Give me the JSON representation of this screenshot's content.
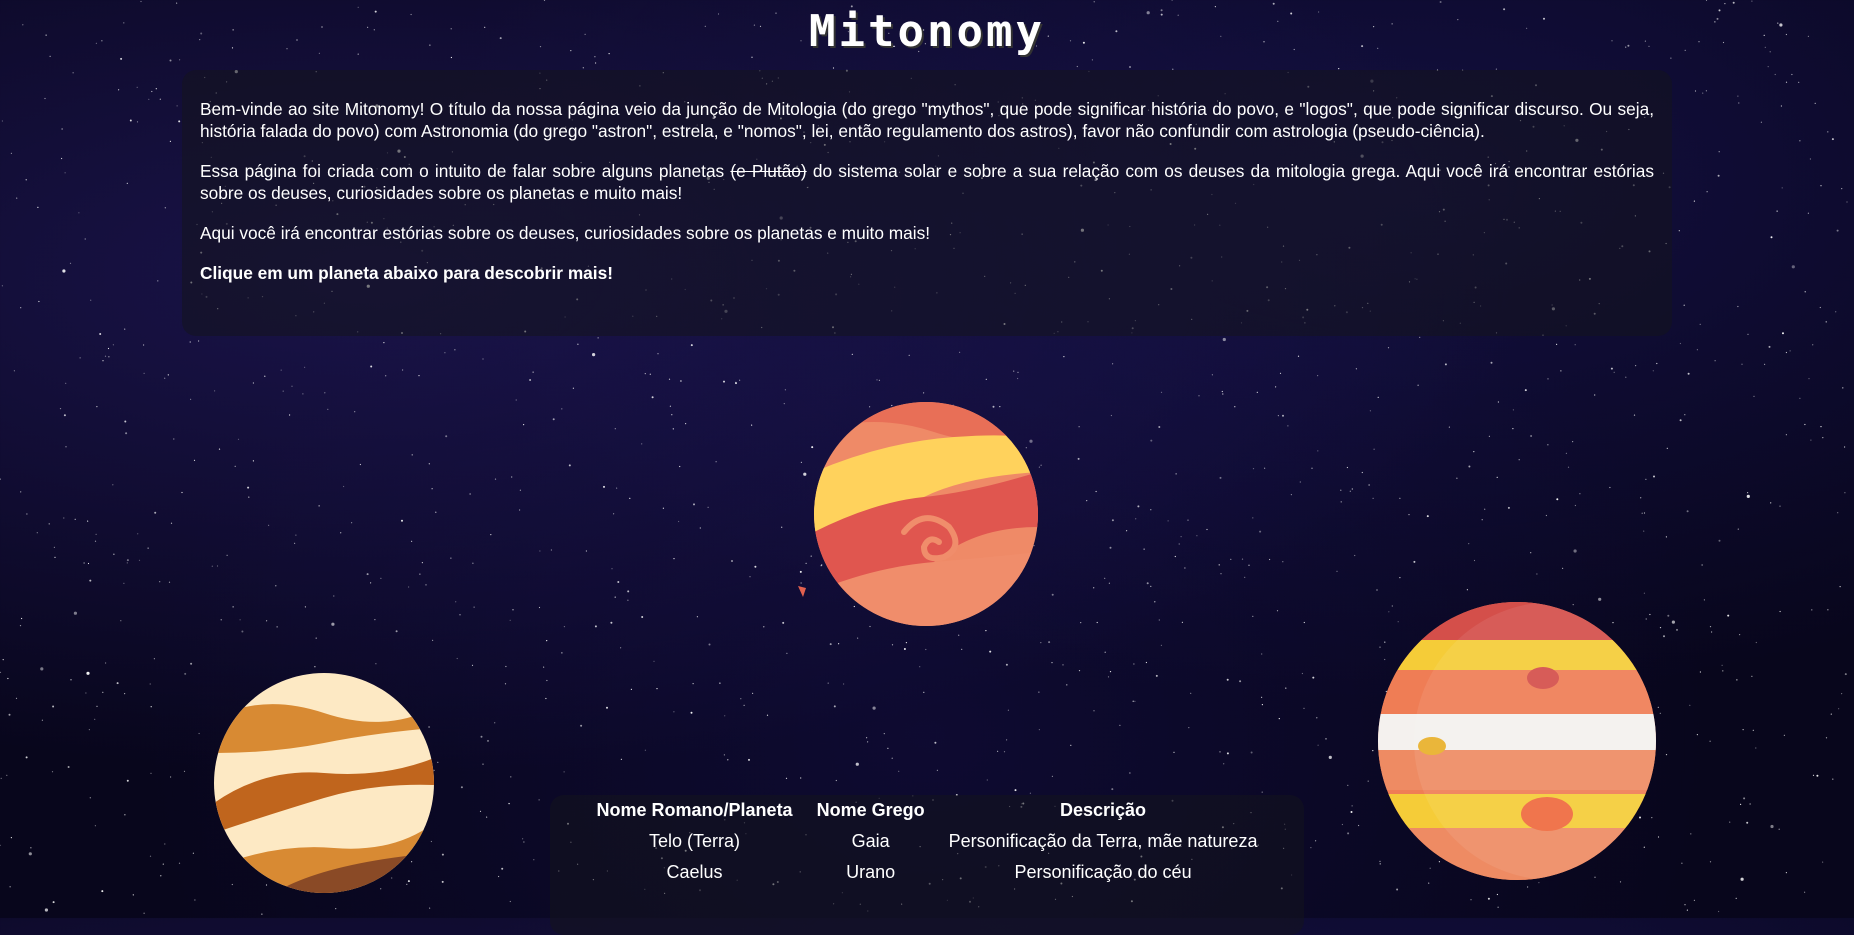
{
  "header": {
    "title": "Mitonomy"
  },
  "intro": {
    "p1": "Bem-vinde ao site Mitonomy! O título da nossa página veio da junção de Mitologia (do grego \"mythos\", que pode significar história do povo, e \"logos\", que pode significar discurso. Ou seja, história falada do povo) com Astronomia (do grego \"astron\", estrela, e \"nomos\", lei, então regulamento dos astros), favor não confundir com astrologia (pseudo-ciência).",
    "p2_before": "Essa página foi criada com o intuito de falar sobre alguns planetas ",
    "p2_strike": "(e Plutão)",
    "p2_after": " do sistema solar e sobre a sua relação com os deuses da mitologia grega. Aqui você irá encontrar estórias sobre os deuses, curiosidades sobre os planetas e muito mais!",
    "p3": "Aqui você irá encontrar estórias sobre os deuses, curiosidades sobre os planetas e muito mais!",
    "cta": "Clique em um planeta abaixo para descobrir mais!"
  },
  "planets": [
    {
      "name": "red-orange-planet",
      "colors": [
        "#ef8a67",
        "#e0564f",
        "#ffd25c"
      ]
    },
    {
      "name": "cream-striped-planet",
      "colors": [
        "#fde9c4",
        "#d88a33",
        "#c0651d"
      ]
    },
    {
      "name": "jupiter-planet",
      "colors": [
        "#ef7d55",
        "#f5cc38",
        "#d44f4a",
        "#f4f1ee"
      ]
    }
  ],
  "table": {
    "headers": [
      "Nome Romano/Planeta",
      "Nome Grego",
      "Descrição"
    ],
    "rows": [
      [
        "Telo (Terra)",
        "Gaia",
        "Personificação da Terra, mãe natureza"
      ],
      [
        "Caelus",
        "Urano",
        "Personificação do céu"
      ]
    ]
  }
}
